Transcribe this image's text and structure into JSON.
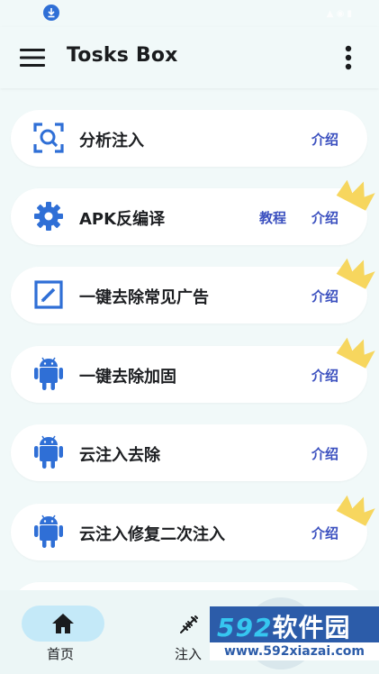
{
  "app_bar": {
    "title": "Tosks Box"
  },
  "items": [
    {
      "title": "分析注入",
      "icon": "scan-search-icon",
      "intro": "介绍"
    },
    {
      "title": "APK反编译",
      "icon": "gear-icon",
      "tutorial": "教程",
      "intro": "介绍"
    },
    {
      "title": "一键去除常见广告",
      "icon": "edit-square-icon",
      "intro": "介绍"
    },
    {
      "title": "一键去除加固",
      "icon": "android-icon",
      "intro": "介绍"
    },
    {
      "title": "云注入去除",
      "icon": "android-icon",
      "intro": "介绍"
    },
    {
      "title": "云注入修复二次注入",
      "icon": "android-icon",
      "intro": "介绍"
    }
  ],
  "bottom_nav": {
    "home": "首页",
    "inject": "注入"
  },
  "watermark": {
    "brand_number": "592",
    "brand_text": "软件园",
    "url": "www.592xiazai.com"
  },
  "colors": {
    "accent": "#2f6fd6",
    "link": "#3a4fbf",
    "crown": "#f6d24c",
    "nav_pill": "#c4e9f8"
  }
}
